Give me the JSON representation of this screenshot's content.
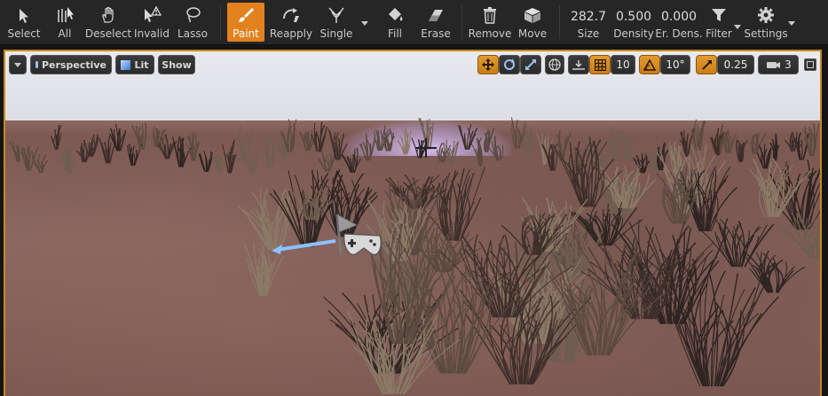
{
  "toolbar": {
    "select": "Select",
    "all": "All",
    "deselect": "Deselect",
    "invalid": "Invalid",
    "lasso": "Lasso",
    "paint": "Paint",
    "reapply": "Reapply",
    "single": "Single",
    "fill": "Fill",
    "erase": "Erase",
    "remove": "Remove",
    "move": "Move",
    "size_value": "282.7",
    "size_label": "Size",
    "density_value": "0.500",
    "density_label": "Density",
    "erase_density_value": "0.000",
    "erase_density_label": "Er. Dens.",
    "filter": "Filter",
    "settings": "Settings"
  },
  "viewport": {
    "view_mode": "Perspective",
    "lighting": "Lit",
    "show": "Show",
    "grid_snap": "10",
    "rotation_snap": "10°",
    "scale_snap": "0.25",
    "camera_speed": "3"
  },
  "colors": {
    "accent": "#e2811d",
    "toolbar_bg": "#262626",
    "viewport_border": "#c58a1b"
  }
}
